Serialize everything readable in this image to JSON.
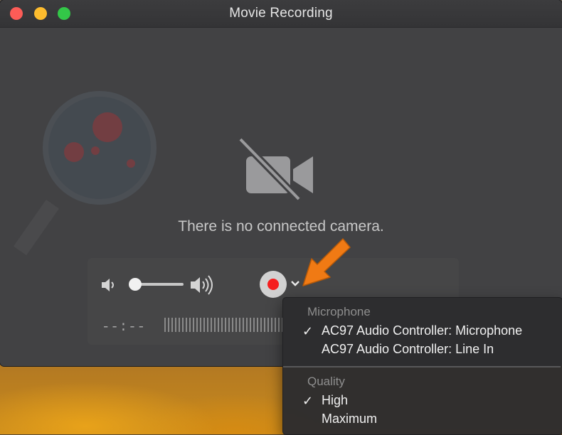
{
  "window": {
    "title": "Movie Recording"
  },
  "viewer": {
    "message": "There is no connected camera.",
    "camera_icon": "video-off-icon"
  },
  "controls": {
    "volume_level": 0.1,
    "timecode": "--:--",
    "record_color": "#f51e1e"
  },
  "options_menu": {
    "microphone_header": "Microphone",
    "microphone_items": [
      {
        "label": "AC97 Audio Controller: Microphone",
        "checked": true,
        "check": "✓"
      },
      {
        "label": "AC97 Audio Controller: Line In",
        "checked": false,
        "check": ""
      }
    ],
    "quality_header": "Quality",
    "quality_items": [
      {
        "label": "High",
        "checked": true,
        "check": "✓"
      },
      {
        "label": "Maximum",
        "checked": false,
        "check": ""
      }
    ]
  },
  "annotation": {
    "arrow_color": "#f07a14"
  }
}
